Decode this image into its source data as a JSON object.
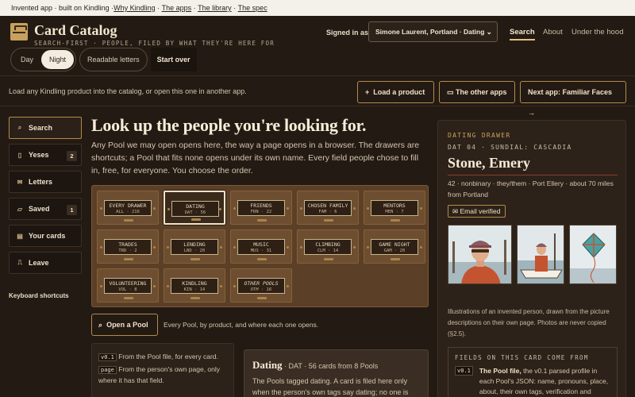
{
  "strip": {
    "prefix": "Invented app · built on Kindling · ",
    "links": [
      "Why Kindling",
      "The apps",
      "The library",
      "The spec"
    ]
  },
  "brand": {
    "title": "Card Catalog",
    "tagline": "SEARCH-FIRST · PEOPLE, FILED BY WHAT THEY'RE HERE FOR"
  },
  "theme": {
    "day": "Day",
    "night": "Night",
    "readable": "Readable letters",
    "start_over": "Start over"
  },
  "account": {
    "signed_in_label": "Signed in as",
    "value": "Simone Laurent, Portland · Dating"
  },
  "nav": {
    "search": "Search",
    "about": "About",
    "under": "Under the hood"
  },
  "loadbar": {
    "text": "Load any Kindling product into the catalog, or open this one in another app.",
    "load": "Load a product",
    "other": "The other apps",
    "next": "Next app: Familiar Faces →"
  },
  "sidebar": {
    "items": [
      {
        "label": "Search",
        "badge": ""
      },
      {
        "label": "Yeses",
        "badge": "2"
      },
      {
        "label": "Letters",
        "badge": ""
      },
      {
        "label": "Saved",
        "badge": "1"
      },
      {
        "label": "Your cards",
        "badge": ""
      }
    ],
    "leave": "Leave",
    "keyboard": "Keyboard shortcuts"
  },
  "main": {
    "title": "Look up the people you're looking for.",
    "lede": "Any Pool we may open opens here, the way a page opens in a browser. The drawers are shortcuts; a Pool that fits none opens under its own name. Every field people chose to fill in, free, for everyone. You choose the order."
  },
  "drawers": [
    {
      "name": "EVERY DRAWER",
      "code": "ALL · 216"
    },
    {
      "name": "DATING",
      "code": "DAT · 56"
    },
    {
      "name": "FRIENDS",
      "code": "FRN · 22"
    },
    {
      "name": "CHOSEN FAMILY",
      "code": "FAM · 6"
    },
    {
      "name": "MENTORS",
      "code": "MEN · 7"
    },
    {
      "name": "TRADES",
      "code": "TRD · 2"
    },
    {
      "name": "LENDING",
      "code": "LND · 20"
    },
    {
      "name": "MUSIC",
      "code": "MUS · 31"
    },
    {
      "name": "CLIMBING",
      "code": "CLM · 14"
    },
    {
      "name": "GAME NIGHT",
      "code": "GAM · 20"
    },
    {
      "name": "VOLUNTEERING",
      "code": "VOL · 8"
    },
    {
      "name": "KINDLING",
      "code": "KIN · 14"
    },
    {
      "name": "OTHER POOLS",
      "code": "OTH · 16"
    }
  ],
  "open_pool": {
    "label": "Open a Pool",
    "text": "Every Pool, by product, and where each one opens."
  },
  "legend": {
    "tag1": "v0.1",
    "line1": "From the Pool file, for every card.",
    "tag2": "page",
    "line2": "From the person's own page, only where it has that field."
  },
  "dating": {
    "title": "Dating",
    "meta": " · DAT · 56 cards from 8 Pools",
    "desc": "The Pools tagged dating. A card is filed here only when the person's own tags say dating; no one is"
  },
  "card": {
    "kicker": "DATING DRAWER",
    "sub": "DAT 04 · SUNDIAL: CASCADIA",
    "name": "Stone, Emery",
    "meta": "42 · nonbinary · they/them · Port Ellery · about 70 miles from Portland",
    "verified": "Email verified",
    "caption": "Illustrations of an invented person, drawn from the picture descriptions on their own page. Photos are never copied (§2.5).",
    "fields_title": "FIELDS ON THIS CARD COME FROM",
    "fields_tag": "v0.1",
    "fields_bold": "The Pool file,",
    "fields_text": " the v0.1 parsed profile in each Pool's JSON: name, pronouns, place, about, their own tags, verification and"
  },
  "colors": {
    "accent": "#c9a15e",
    "bg": "#231a13",
    "border": "#b58b4a"
  }
}
